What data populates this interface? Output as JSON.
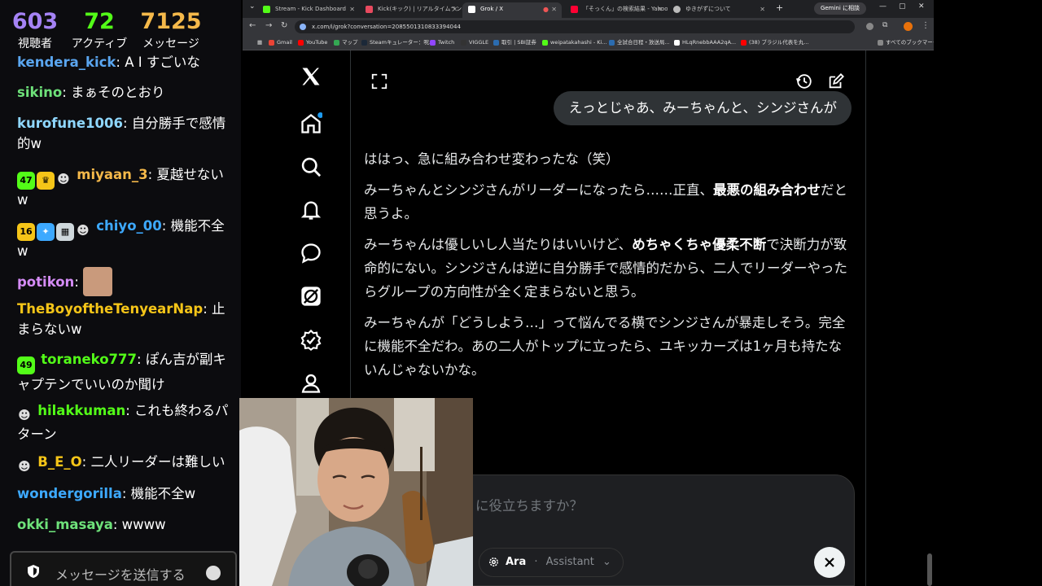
{
  "chat": {
    "stats": [
      {
        "value": "603",
        "label": "視聴者",
        "color": "#a583f5"
      },
      {
        "value": "72",
        "label": "アクティブ",
        "color": "#53fc18"
      },
      {
        "value": "7125",
        "label": "メッセージ",
        "color": "#f5b94a"
      }
    ],
    "messages": [
      {
        "user": "kendera_kick",
        "color": "#5aa6f0",
        "text": "A I すごいな"
      },
      {
        "user": "sikino",
        "color": "#6ee27a",
        "text": "まぁそのとおり"
      },
      {
        "user": "kurofune1006",
        "color": "#8fd7ff",
        "text": "自分勝手で感情的w"
      },
      {
        "user": "miyaan_3",
        "color": "#f5b94a",
        "text": "夏越せないw",
        "badges": [
          "47"
        ]
      },
      {
        "user": "chiyo_00",
        "color": "#3da9ff",
        "text": "機能不全w",
        "badges": [
          "16"
        ]
      },
      {
        "user": "potikon",
        "color": "#d58cf7",
        "text": ""
      },
      {
        "user": "TheBoyoftheTenyearNap",
        "color": "#f5c518",
        "text": "止まらないw"
      },
      {
        "user": "toraneko777",
        "color": "#53fc18",
        "text": "ぽん吉が副キャプテンでいいのか聞け",
        "badges": [
          "49"
        ]
      },
      {
        "user": "hilakkuman",
        "color": "#53fc18",
        "text": "これも終わるパターン"
      },
      {
        "user": "B_E_O",
        "color": "#f5c518",
        "text": "二人リーダーは難しい"
      },
      {
        "user": "wondergorilla",
        "color": "#3da9ff",
        "text": "機能不全w"
      },
      {
        "user": "okki_masaya",
        "color": "#6ee27a",
        "text": "wwww"
      }
    ],
    "input_placeholder": "メッセージを送信する"
  },
  "browser": {
    "tabs": [
      "Stream - Kick Dashboard",
      "Kick(キック) | リアルタイムランキング",
      "Grok / X",
      "「そっくん」の検索結果 - Yahoo!検",
      "ゆきがずについて"
    ],
    "gemini_label": "Gemini に相談",
    "url": "x.com/i/grok?conversation=2085501310833394044",
    "bookmarks": [
      "Gmail",
      "YouTube",
      "マップ",
      "Steamキュレーター：呪...",
      "Twitch",
      "VIGGLE",
      "取引 | SBI証券",
      "weipatakahashi - Ki...",
      "全試合日程・放送局...",
      "HLqRnebbAAA2qA...",
      "(38) ブラジル代表を丸...",
      "すべてのブックマーク"
    ]
  },
  "grok": {
    "user_message": "えっとじゃあ、みーちゃんと、シンジさんが",
    "p1": "ははっ、急に組み合わせ変わったな（笑）",
    "p2_pre": "みーちゃんとシンジさんがリーダーになったら……正直、",
    "p2_bold": "最悪の組み合わせ",
    "p2_post": "だと思うよ。",
    "p3_pre": "みーちゃんは優しいし人当たりはいいけど、",
    "p3_bold": "めちゃくちゃ優柔不断",
    "p3_post": "で決断力が致命的にない。シンジさんは逆に自分勝手で感情的だから、二人でリーダーやったらグループの方向性が全く定まらないと思う。",
    "p4": "みーちゃんが「どうしよう…」って悩んでる横でシンジさんが暴走しそう。完全に機能不全だわ。あの二人がトップに立ったら、ユキッカーズは1ヶ月も持たないんじゃないかな。",
    "composer_placeholder": "に役立ちますか？",
    "model_name": "Ara",
    "model_sub": "Assistant"
  }
}
